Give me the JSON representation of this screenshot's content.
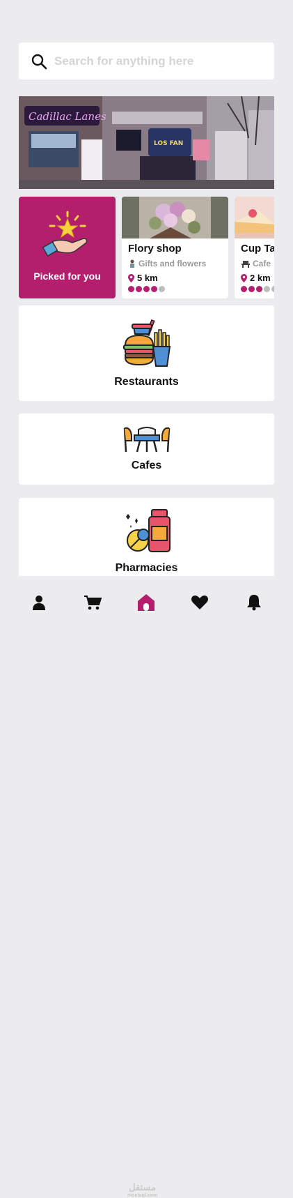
{
  "search": {
    "placeholder": "Search for anything here",
    "value": ""
  },
  "banner": {
    "neon_sign": "Cadillac Lanes",
    "store_sign": "LOS FAN"
  },
  "picked": {
    "label": "Picked for you"
  },
  "shops": [
    {
      "name": "Flory shop",
      "category": "Gifts and flowers",
      "distance": "5 km",
      "rating": 4,
      "rating_max": 5
    },
    {
      "name": "Cup Ta",
      "category": "Cafe",
      "distance": "2 km",
      "rating": 3,
      "rating_max": 5
    }
  ],
  "categories": [
    {
      "title": "Restaurants"
    },
    {
      "title": "Cafes"
    },
    {
      "title": "Pharmacies"
    }
  ],
  "nav": {
    "items": [
      "profile-icon",
      "cart-icon",
      "home-icon",
      "heart-icon",
      "bell-icon"
    ],
    "active": "home-icon",
    "accent": "#b31f6d"
  },
  "watermark": {
    "arabic": "مستقل",
    "latin": "mostaql.com"
  },
  "colors": {
    "accent": "#b31f6d",
    "background": "#ecebed"
  }
}
